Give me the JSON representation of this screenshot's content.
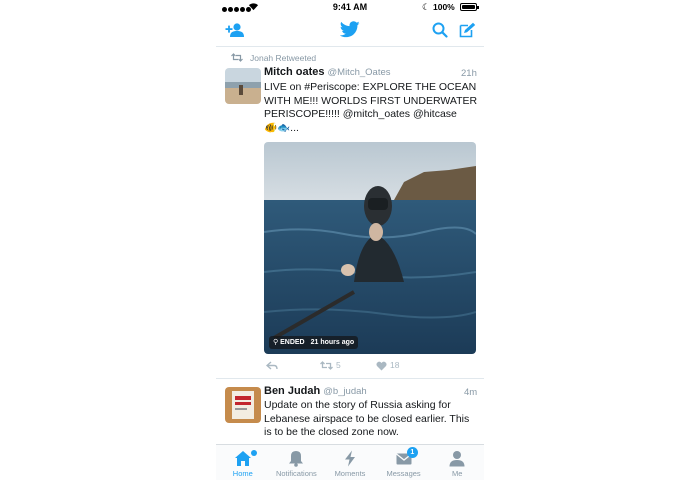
{
  "status_bar": {
    "time": "9:41 AM",
    "battery": "100%"
  },
  "retweet_context": "Jonah Retweeted",
  "tweets": [
    {
      "name": "Mitch oates",
      "handle": "@Mitch_Oates",
      "age": "21h",
      "text": "LIVE on #Periscope:   EXPLORE THE OCEAN WITH ME!!! WORLDS FIRST UNDERWATER PERISCOPE!!!!! @mitch_oates @hitcase",
      "emoji_line": "🐠🐟...",
      "video_status": "ENDED",
      "video_age": "21 hours ago",
      "retweet_count": "5",
      "like_count": "18"
    },
    {
      "name": "Ben Judah",
      "handle": "@b_judah",
      "age": "4m",
      "text": "Update on the story of Russia asking for Lebanese airspace to be closed earlier. This is to be the closed zone now."
    }
  ],
  "tabs": [
    {
      "label": "Home",
      "icon": "home-icon"
    },
    {
      "label": "Notifications",
      "icon": "bell-icon"
    },
    {
      "label": "Moments",
      "icon": "lightning-icon"
    },
    {
      "label": "Messages",
      "icon": "envelope-icon",
      "badge": "1"
    },
    {
      "label": "Me",
      "icon": "person-icon"
    }
  ],
  "colors": {
    "accent": "#1da1f2",
    "text": "#14171a",
    "muted": "#8899a6",
    "divider": "#e1e8ed"
  }
}
